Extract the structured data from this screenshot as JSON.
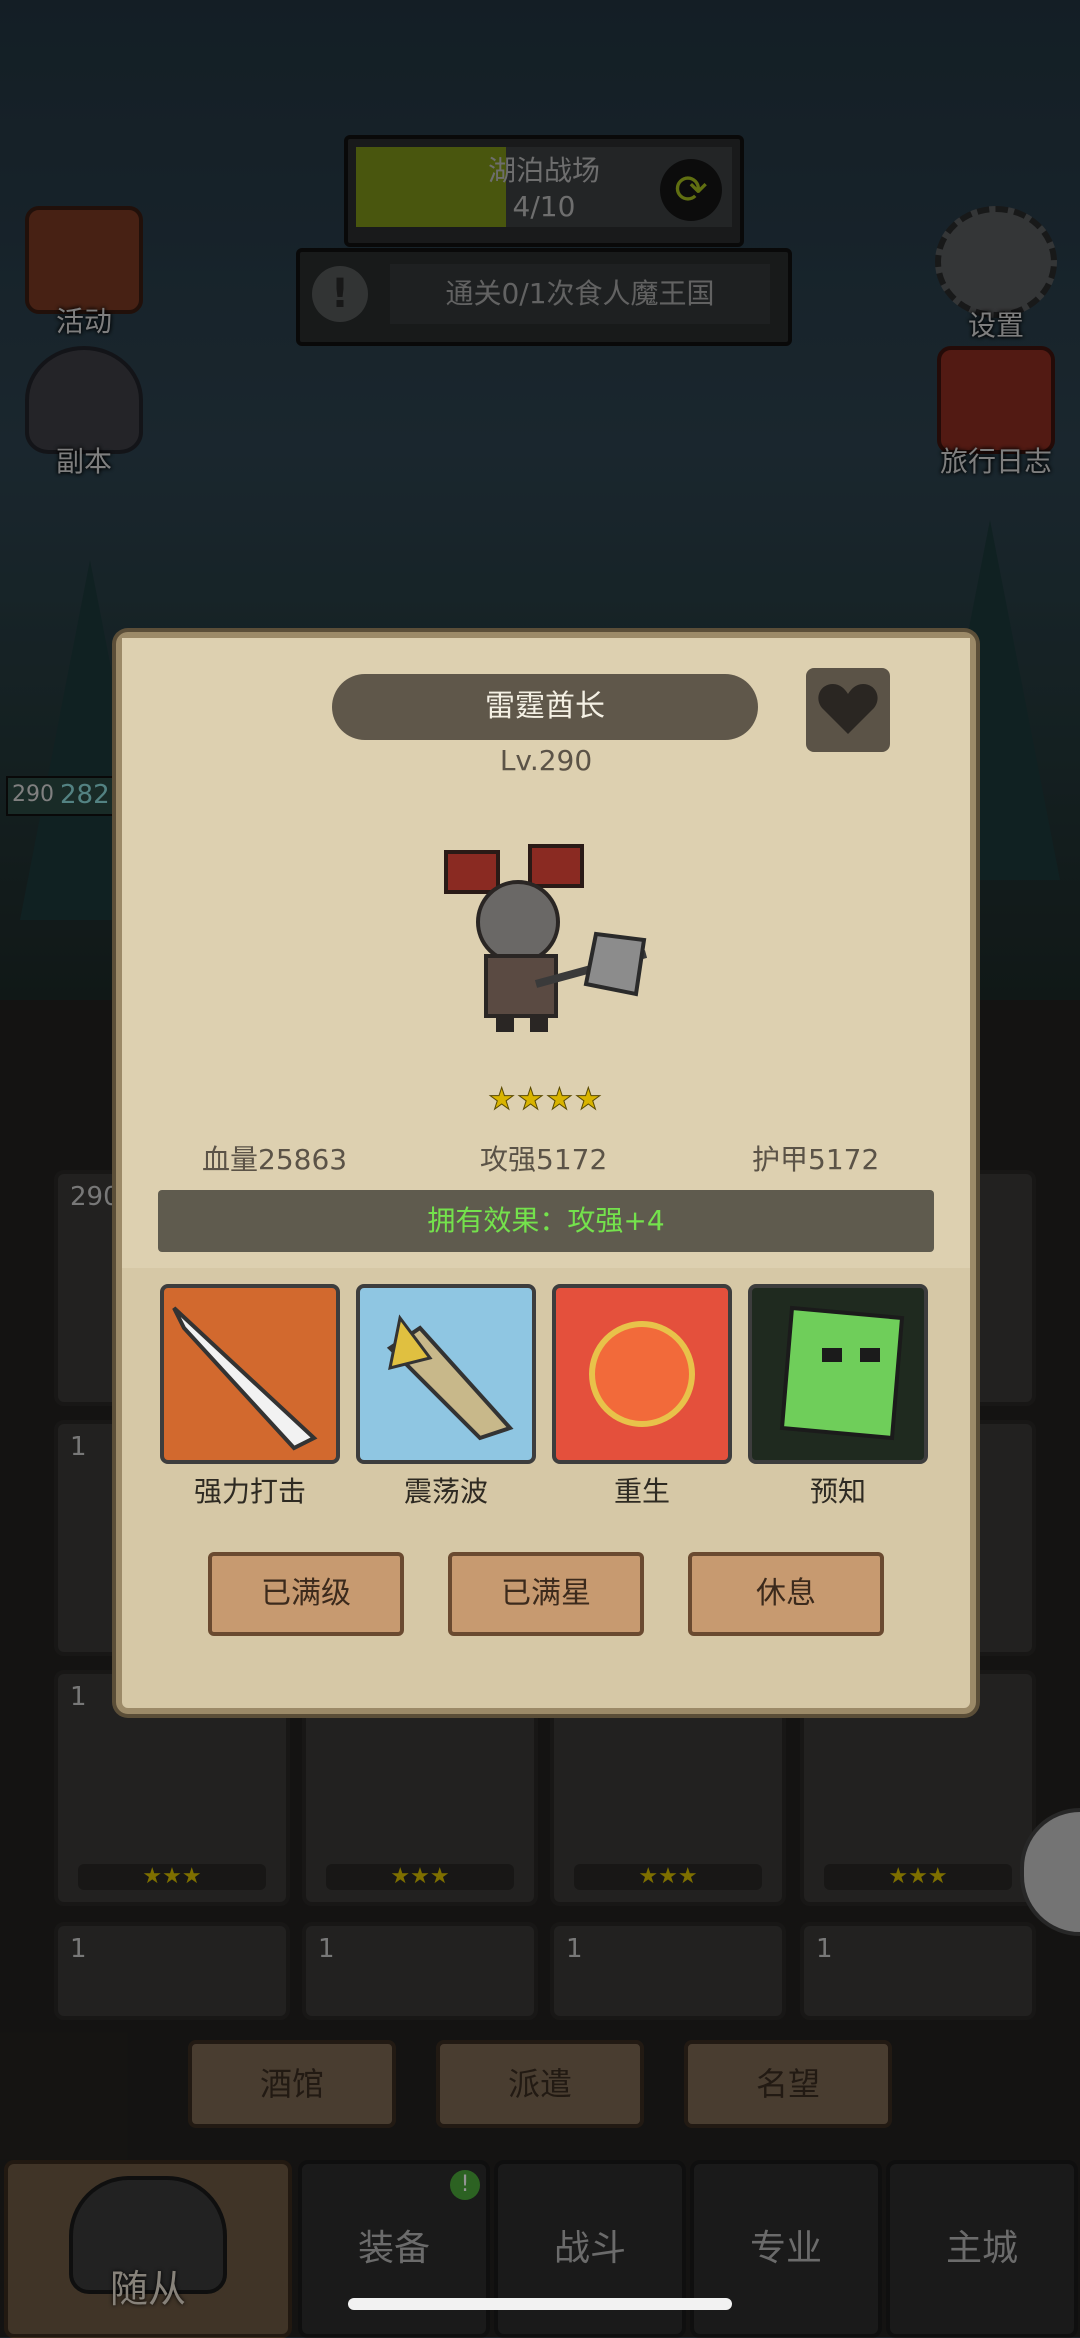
{
  "top": {
    "stage_name": "湖泊战场",
    "stage_progress": "4/10",
    "stage_progress_fraction": 0.4,
    "quest_text": "通关0/1次食人魔王国"
  },
  "side_icons": {
    "activity": "活动",
    "dungeon": "副本",
    "settings": "设置",
    "travel_log": "旅行日志"
  },
  "background_hero": {
    "level": "290",
    "number_partial": "282"
  },
  "grid": {
    "rows": [
      {
        "count": "1",
        "stars": "★★★"
      },
      {
        "count": "1",
        "stars": "★★★"
      },
      {
        "count": "1",
        "stars": "★★★"
      },
      {
        "count": "1",
        "stars": "★★★"
      }
    ],
    "bottom_counts": [
      "1",
      "1",
      "1",
      "1"
    ],
    "first_col_counts": [
      "290",
      "1",
      "1"
    ]
  },
  "sub_tabs": [
    "酒馆",
    "派遣",
    "名望"
  ],
  "nav_tabs": [
    "随从",
    "装备",
    "战斗",
    "专业",
    "主城"
  ],
  "modal": {
    "hero_name": "雷霆酋长",
    "level": "Lv.290",
    "stars": "★★★★",
    "star_count": 4,
    "hp": "血量25863",
    "attack": "攻强5172",
    "armor": "护甲5172",
    "effect": "拥有效果：攻强+4",
    "skills": [
      {
        "name": "强力打击",
        "icon": "sword-strike-icon"
      },
      {
        "name": "震荡波",
        "icon": "shockwave-icon"
      },
      {
        "name": "重生",
        "icon": "rebirth-icon"
      },
      {
        "name": "预知",
        "icon": "foresight-icon"
      }
    ],
    "buttons": {
      "max_level": "已满级",
      "max_star": "已满星",
      "rest": "休息"
    }
  },
  "colors": {
    "effect_text": "#74e24c",
    "progress_fill": "#7f9419"
  }
}
